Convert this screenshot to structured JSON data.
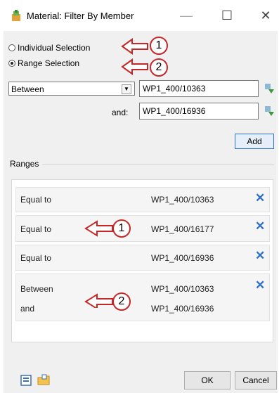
{
  "window": {
    "title": "Material: Filter By Member",
    "minimize_glyph": "—",
    "maximize_glyph": "☐",
    "close_glyph": "✕"
  },
  "selection": {
    "individual_label": "Individual Selection",
    "range_label": "Range Selection",
    "selected": "range"
  },
  "range_inputs": {
    "operator": "Between",
    "from_value": "WP1_400/10363",
    "and_label": "and:",
    "to_value": "WP1_400/16936",
    "add_label": "Add"
  },
  "ranges": {
    "legend": "Ranges",
    "rows": [
      {
        "op": "Equal to",
        "value": "WP1_400/10363",
        "remove": "✕"
      },
      {
        "op": "Equal to",
        "value": "WP1_400/16177",
        "remove": "✕"
      },
      {
        "op": "Equal to",
        "value": "WP1_400/16936",
        "remove": "✕"
      },
      {
        "op": "Between",
        "op2": "and",
        "value": "WP1_400/10363",
        "value2": "WP1_400/16936",
        "remove": "✕"
      }
    ]
  },
  "footer": {
    "ok_label": "OK",
    "cancel_label": "Cancel"
  },
  "annotations": {
    "one": "1",
    "two": "2"
  },
  "colors": {
    "accent": "#2f6fc7",
    "annotation": "#c62828"
  },
  "icons": {
    "app": "material-icon",
    "pick": "pick-value-icon",
    "footer_left": "clipboard-icon",
    "footer_right": "folder-icon"
  }
}
